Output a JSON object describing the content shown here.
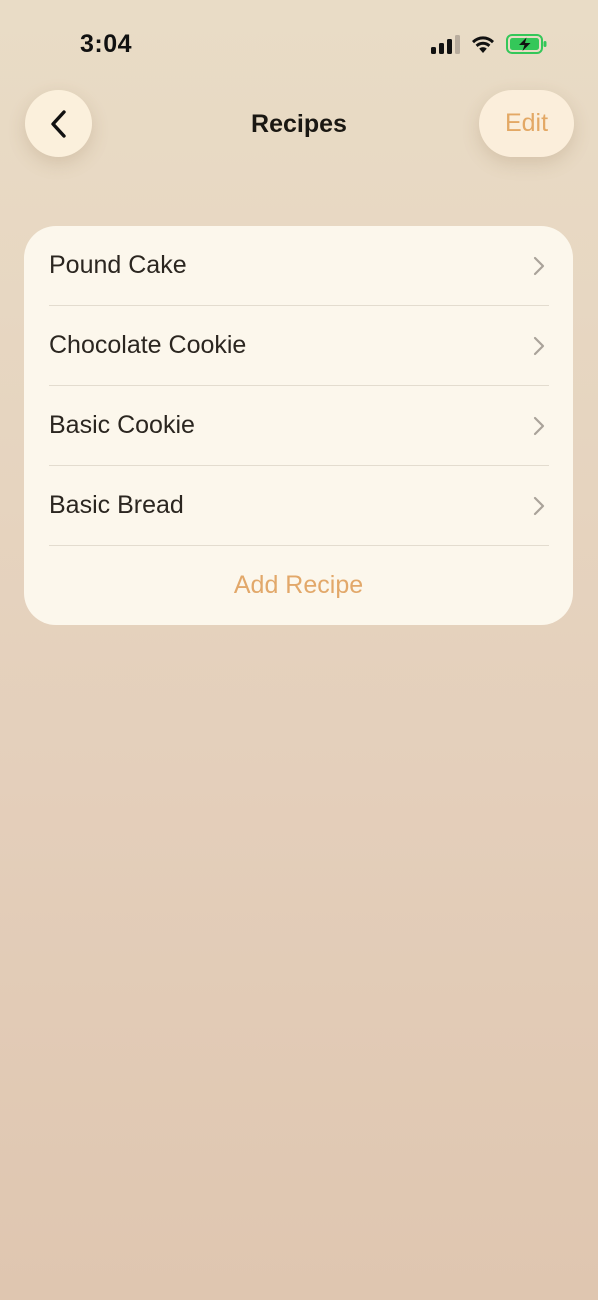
{
  "status_bar": {
    "time": "3:04",
    "icons": [
      "signal-icon",
      "wifi-icon",
      "battery-charging-icon"
    ],
    "battery_color": "#34c759"
  },
  "nav": {
    "back_icon": "chevron-left-icon",
    "title": "Recipes",
    "edit_label": "Edit"
  },
  "recipes": {
    "items": [
      {
        "label": "Pound Cake"
      },
      {
        "label": "Chocolate Cookie"
      },
      {
        "label": "Basic Cookie"
      },
      {
        "label": "Basic Bread"
      }
    ],
    "add_label": "Add Recipe"
  },
  "colors": {
    "accent": "#e3a865",
    "card_background": "#fcf7ec",
    "button_background": "#fbf0dc"
  }
}
